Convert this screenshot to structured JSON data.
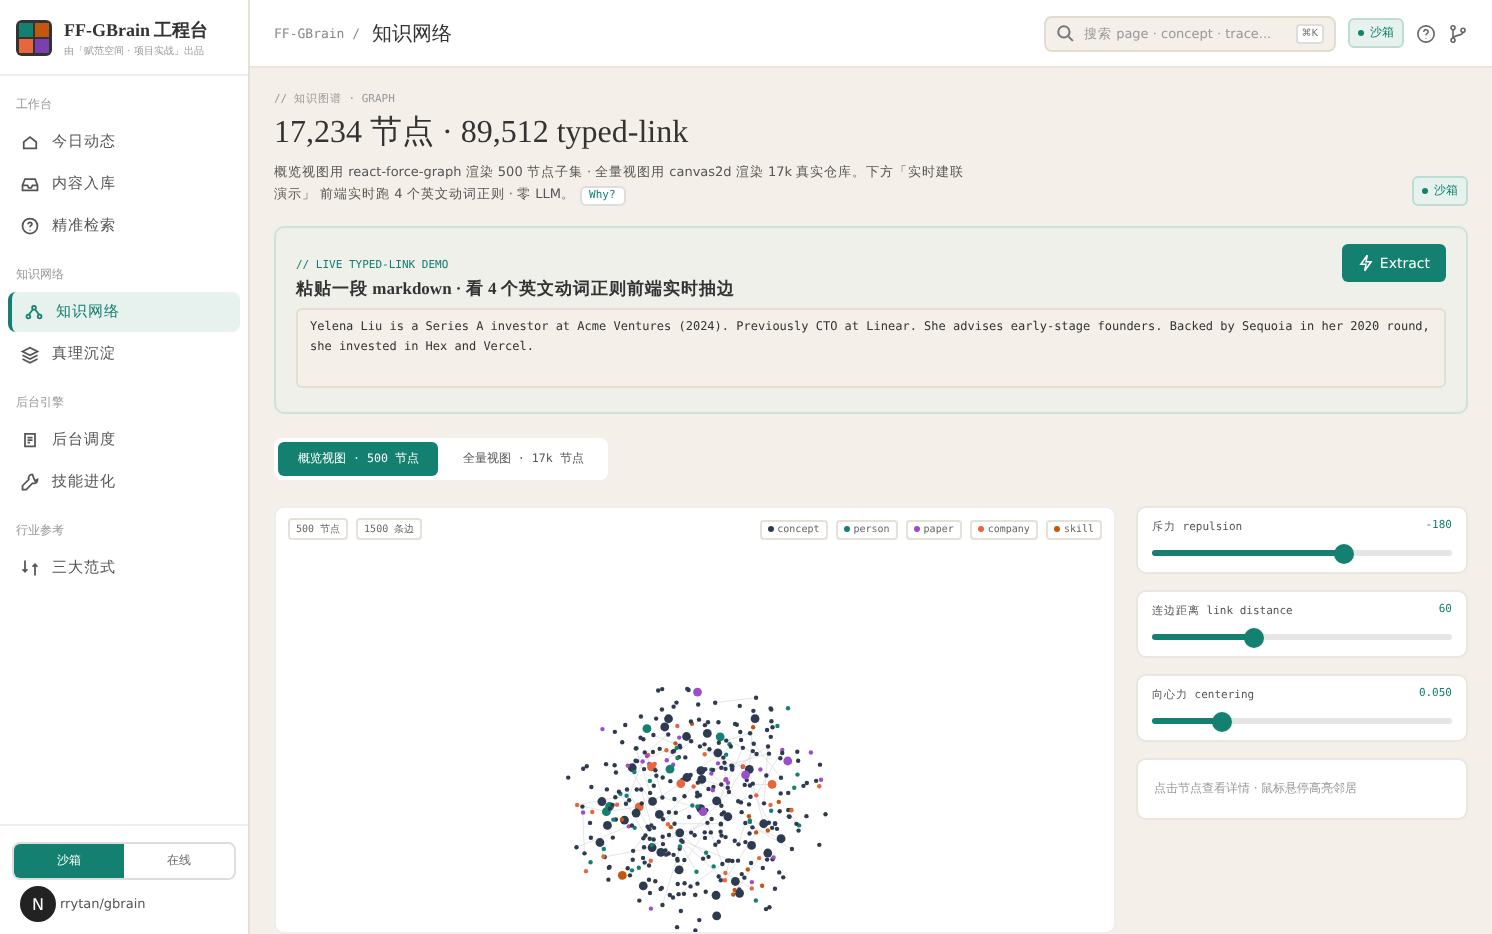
{
  "brand": {
    "name": "FF-GBrain 工程台",
    "subtitle": "由「赋范空间 · 项目实战」出品"
  },
  "sidebar": {
    "sections": [
      {
        "title": "工作台",
        "items": [
          {
            "label": "今日动态",
            "selected": false
          },
          {
            "label": "内容入库",
            "selected": false
          },
          {
            "label": "精准检索",
            "selected": false
          }
        ]
      },
      {
        "title": "知识网络",
        "items": [
          {
            "label": "知识网络",
            "selected": true
          },
          {
            "label": "真理沉淀",
            "selected": false
          }
        ]
      },
      {
        "title": "后台引擎",
        "items": [
          {
            "label": "后台调度",
            "selected": false
          },
          {
            "label": "技能进化",
            "selected": false
          }
        ]
      },
      {
        "title": "行业参考",
        "items": [
          {
            "label": "三大范式",
            "selected": false
          }
        ]
      }
    ],
    "mode_toggle": [
      {
        "label": "沙箱",
        "selected": true
      },
      {
        "label": "在线",
        "selected": false
      }
    ],
    "repo": "rrytan/gbrain",
    "avatar": "N"
  },
  "topbar": {
    "breadcrumb": "FF-GBrain /",
    "title": "知识网络",
    "search": {
      "placeholder": "搜索 page · concept · trace...",
      "shortcut": "⌘K"
    },
    "badge": "沙箱"
  },
  "header": {
    "eyebrow": "// 知识图谱 · GRAPH",
    "title": "17,234 节点 · 89,512 typed-link",
    "description": "概览视图用 react-force-graph 渲染 500 节点子集 · 全量视图用 canvas2d 渲染 17k 真实仓库。下方「实时建联演示」 前端实时跑 4 个英文动词正则 · 零 LLM。",
    "why": "Why?",
    "badge": "沙箱"
  },
  "demo": {
    "eyebrow": "// LIVE TYPED-LINK DEMO",
    "title": "粘贴一段 markdown · 看 4 个英文动词正则前端实时抽边",
    "button": "Extract",
    "text": "Yelena Liu is a Series A investor at Acme Ventures (2024). Previously CTO at Linear. She advises early-stage founders. Backed by Sequoia in her 2020 round, she invested in Hex and Vercel."
  },
  "view_tabs": [
    {
      "label": "概览视图 · 500 节点",
      "selected": true
    },
    {
      "label": "全量视图 · 17k 节点",
      "selected": false
    }
  ],
  "graph": {
    "stats": [
      "500 节点",
      "1500 条边"
    ],
    "legend": [
      {
        "label": "concept",
        "color": "#2e3a4f"
      },
      {
        "label": "person",
        "color": "#14806f"
      },
      {
        "label": "paper",
        "color": "#9b4dca"
      },
      {
        "label": "company",
        "color": "#e8663d"
      },
      {
        "label": "skill",
        "color": "#c2570f"
      }
    ]
  },
  "controls": [
    {
      "label": "斥力 repulsion",
      "reading": "-180",
      "level": 0.64
    },
    {
      "label": "连边距离 link distance",
      "reading": "60",
      "level": 0.34
    },
    {
      "label": "向心力 centering",
      "reading": "0.050",
      "level": 0.23
    }
  ],
  "hint": "点击节点查看详情 · 鼠标悬停高亮邻居"
}
